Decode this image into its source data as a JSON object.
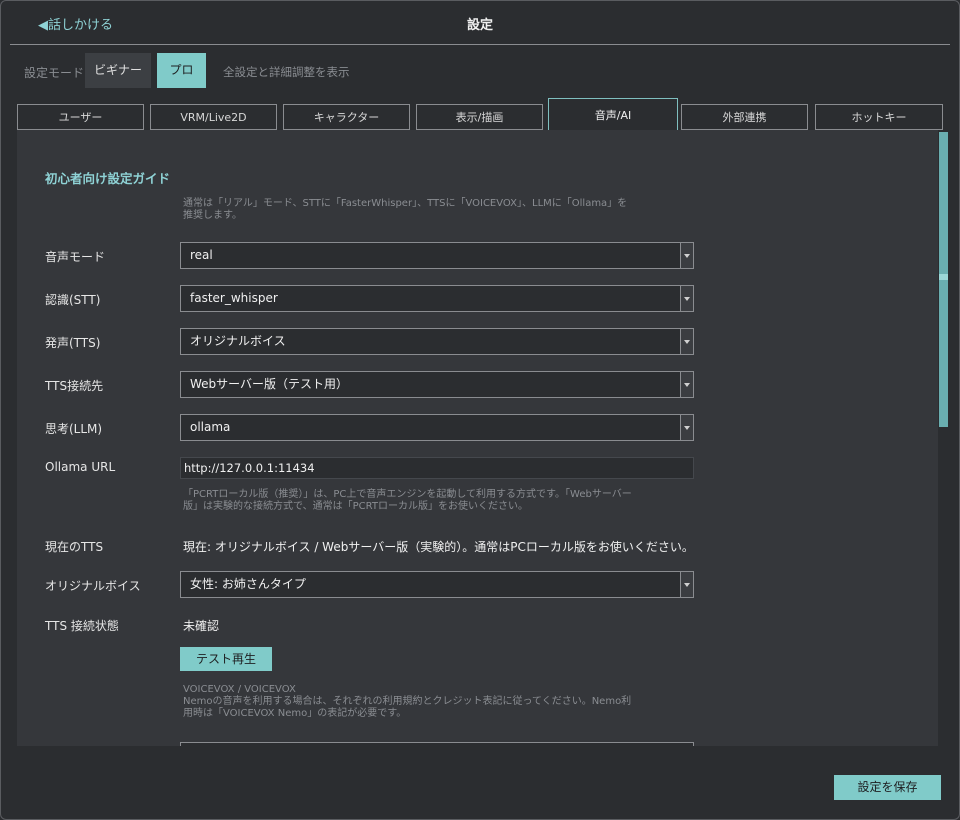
{
  "header": {
    "back_label": "◀話しかける",
    "title": "設定"
  },
  "mode": {
    "label": "設定モード",
    "beginner": "ビギナー",
    "pro": "プロ",
    "description": "全設定と詳細調整を表示"
  },
  "tabs": [
    "ユーザー",
    "VRM/Live2D",
    "キャラクター",
    "表示/描画",
    "音声/AI",
    "外部連携",
    "ホットキー"
  ],
  "active_tab": "音声/AI",
  "section": {
    "title": "初心者向け設定ガイド",
    "guide": "通常は「リアル」モード、STTに「FasterWhisper」、TTSに「VOICEVOX」、LLMに「Ollama」を推奨します。"
  },
  "fields": {
    "voice_mode": {
      "label": "音声モード",
      "value": "real"
    },
    "stt": {
      "label": "認識(STT)",
      "value": "faster_whisper"
    },
    "tts": {
      "label": "発声(TTS)",
      "value": "オリジナルボイス"
    },
    "tts_conn": {
      "label": "TTS接続先",
      "value": "Webサーバー版（テスト用）"
    },
    "llm": {
      "label": "思考(LLM)",
      "value": "ollama"
    },
    "ollama_url": {
      "label": "Ollama URL",
      "value": "http://127.0.0.1:11434"
    },
    "conn_hint": "「PCRTローカル版（推奨）」は、PC上で音声エンジンを起動して利用する方式です。「Webサーバー版」は実験的な接続方式で、通常は「PCRTローカル版」をお使いください。",
    "current_tts": {
      "label": "現在のTTS",
      "value": "現在: オリジナルボイス / Webサーバー版（実験的）。通常はPCローカル版をお使いください。"
    },
    "original_voice": {
      "label": "オリジナルボイス",
      "value": "女性: お姉さんタイプ"
    },
    "tts_status": {
      "label": "TTS 接続状態",
      "value": "未確認"
    },
    "test_button": "テスト再生",
    "credit_title": "VOICEVOX / VOICEVOX",
    "credit_text": "Nemoの音声を利用する場合は、それぞれの利用規約とクレジット表記に従ってください。Nemo利用時は「VOICEVOX Nemo」の表記が必要です。"
  },
  "footer": {
    "save_label": "設定を保存"
  },
  "colors": {
    "accent": "#80cbc9",
    "background": "#2b2d30",
    "panel": "#35373b"
  }
}
